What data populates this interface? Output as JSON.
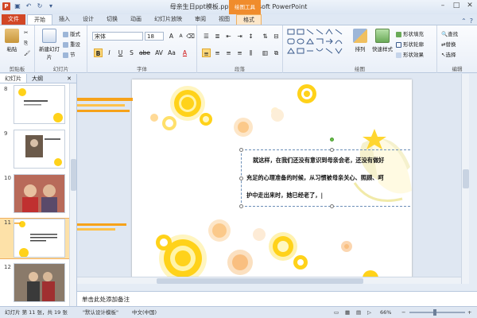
{
  "window": {
    "title": "母亲生日ppt模板.pptx - Microsoft PowerPoint",
    "context_group": "绘图工具",
    "controls": [
      "–",
      "□",
      "✕"
    ]
  },
  "tabs": [
    "文件",
    "开始",
    "插入",
    "设计",
    "切换",
    "动画",
    "幻灯片放映",
    "审阅",
    "视图",
    "格式"
  ],
  "ribbon": {
    "clipboard": {
      "label": "剪贴板",
      "paste": "粘贴"
    },
    "slides": {
      "label": "幻灯片",
      "new_slide": "新建幻灯片",
      "layout": "版式",
      "reset": "重设",
      "section": "节"
    },
    "font": {
      "label": "字体",
      "font_name": "宋体",
      "font_size": "18",
      "bold": "B",
      "italic": "I",
      "underline": "U",
      "shadow": "S",
      "strike": "abe",
      "spacing": "AV",
      "case": "Aa",
      "color": "A"
    },
    "paragraph": {
      "label": "段落"
    },
    "drawing": {
      "label": "绘图",
      "arrange": "排列",
      "quick_styles": "快速样式",
      "shape_fill": "形状填充",
      "shape_outline": "形状轮廓",
      "shape_effects": "形状效果"
    },
    "editing": {
      "label": "编辑",
      "find": "查找",
      "replace": "替换",
      "select": "选择"
    }
  },
  "panel": {
    "tab_slides": "幻灯片",
    "tab_outline": "大纲",
    "thumbnails": [
      {
        "num": "8"
      },
      {
        "num": "9"
      },
      {
        "num": "10"
      },
      {
        "num": "11"
      },
      {
        "num": "12"
      }
    ],
    "selected": "11"
  },
  "slide": {
    "text_lines": [
      "就这样，在我们还没有意识到母亲会老，还没有做好",
      "充足的心理准备的时候，从习惯被母亲关心、照顾、呵",
      "护中走出来时，她已经老了，|"
    ]
  },
  "notes": {
    "placeholder": "单击此处添加备注"
  },
  "status": {
    "slide_info": "幻灯片 第 11 张，共 19 张",
    "theme": "\"默认设计模板\"",
    "language": "中文(中国)",
    "zoom": "66%",
    "zoom_minus": "−",
    "zoom_plus": "+"
  },
  "colors": {
    "file_tab": "#d24726",
    "context_tab": "#f08c2c",
    "circle_yellow": "#ffd21a",
    "circle_orange": "#f6a21a"
  }
}
